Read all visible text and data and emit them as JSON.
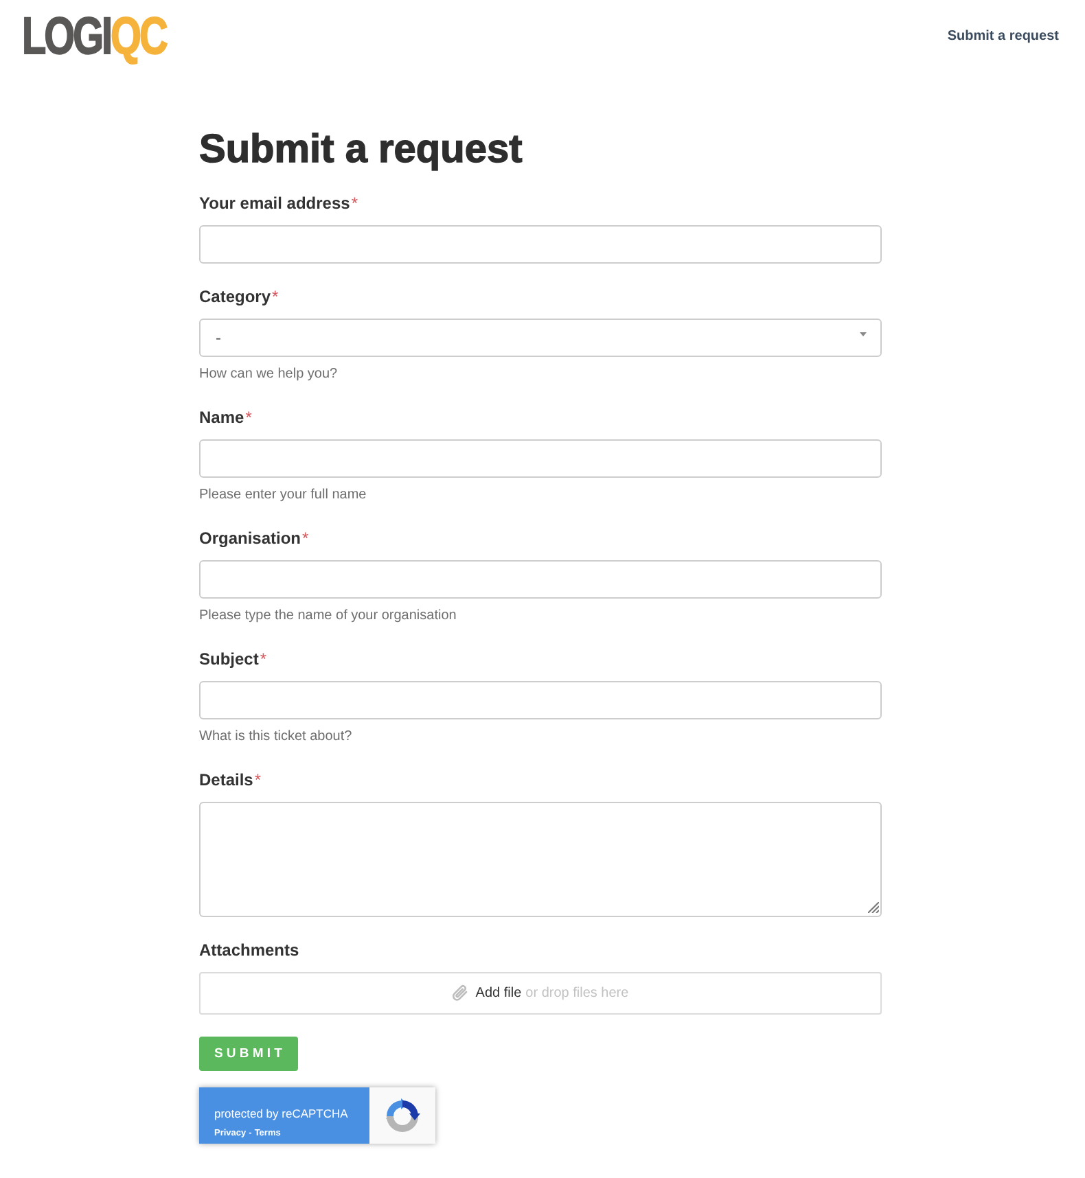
{
  "header": {
    "logo": {
      "primary": "LOGI",
      "accent": "QC"
    },
    "nav_link": "Submit a request"
  },
  "title": "Submit a request",
  "form": {
    "required_marker": "*",
    "fields": [
      {
        "kind": "text",
        "label": "Your email address",
        "required": true
      },
      {
        "kind": "select",
        "label": "Category",
        "required": true,
        "value": "-",
        "hint": "How can we help you?"
      },
      {
        "kind": "text",
        "label": "Name",
        "required": true,
        "hint": "Please enter your full name"
      },
      {
        "kind": "text",
        "label": "Organisation",
        "required": true,
        "hint": "Please type the name of your organisation"
      },
      {
        "kind": "text",
        "label": "Subject",
        "required": true,
        "hint": "What is this ticket about?"
      },
      {
        "kind": "textarea",
        "label": "Details",
        "required": true
      },
      {
        "kind": "file",
        "label": "Attachments",
        "required": false,
        "link": "Add file",
        "text": "or drop files here"
      }
    ],
    "submit": "SUBMIT"
  },
  "captcha": {
    "title": "protected by reCAPTCHA",
    "links": [
      "Privacy",
      "Terms"
    ],
    "separator": "-"
  }
}
